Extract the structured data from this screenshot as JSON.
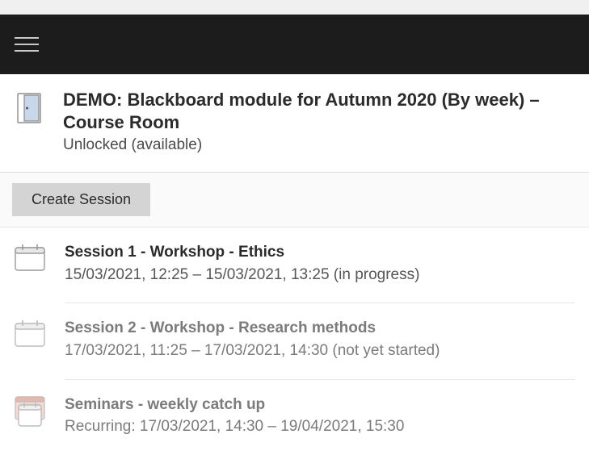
{
  "course_room": {
    "title": "DEMO: Blackboard module for Autumn 2020 (By week) – Course Room",
    "status": "Unlocked (available)"
  },
  "toolbar": {
    "create_session_label": "Create Session"
  },
  "sessions": [
    {
      "title": "Session 1 - Workshop - Ethics",
      "detail": "15/03/2021, 12:25 – 15/03/2021, 13:25 (in progress)",
      "active": true,
      "recurring": false
    },
    {
      "title": "Session 2 - Workshop - Research methods",
      "detail": "17/03/2021, 11:25 – 17/03/2021, 14:30 (not yet started)",
      "active": false,
      "recurring": false
    },
    {
      "title": "Seminars - weekly catch up",
      "detail": "Recurring: 17/03/2021, 14:30 – 19/04/2021, 15:30",
      "active": false,
      "recurring": true
    }
  ]
}
